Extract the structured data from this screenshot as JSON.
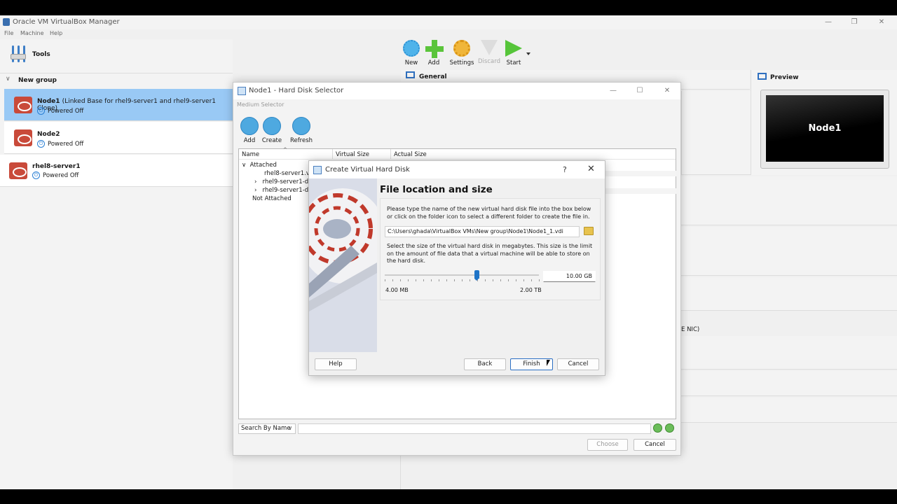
{
  "app": {
    "title": "Oracle VM VirtualBox Manager",
    "menu": [
      "File",
      "Machine",
      "Help"
    ],
    "tools_label": "Tools",
    "group_label": "New group"
  },
  "vms": [
    {
      "name": "Node1",
      "note": "(Linked Base for rhel9-server1 and rhel9-server1 Clone)",
      "state": "Powered Off"
    },
    {
      "name": "Node2",
      "note": "",
      "state": "Powered Off"
    },
    {
      "name": "rhel8-server1",
      "note": "",
      "state": "Powered Off"
    }
  ],
  "toolbar": {
    "new": "New",
    "add": "Add",
    "settings": "Settings",
    "discard": "Discard",
    "start": "Start"
  },
  "details": {
    "general": "General",
    "preview": "Preview",
    "preview_vm": "Node1",
    "nic_fragment": "E NIC)"
  },
  "hds": {
    "title": "Node1 - Hard Disk Selector",
    "section": "Medium Selector",
    "add": "Add",
    "create": "Create",
    "refresh": "Refresh",
    "col_name": "Name",
    "col_virtual": "Virtual Size",
    "col_actual": "Actual Size",
    "attached": "Attached",
    "items": [
      "rhel8-server1.vdi",
      "rhel9-server1-dis",
      "rhel9-server1-dis"
    ],
    "not_attached": "Not Attached",
    "search_mode": "Search By Name",
    "choose": "Choose",
    "cancel": "Cancel"
  },
  "cvhd": {
    "title": "Create Virtual Hard Disk",
    "help_glyph": "?",
    "page_title": "File location and size",
    "desc1": "Please type the name of the new virtual hard disk file into the box below or click on the folder icon to select a different folder to create the file in.",
    "path": "C:\\Users\\ghada\\VirtualBox VMs\\New group\\Node1\\Node1_1.vdi",
    "desc2": "Select the size of the virtual hard disk in megabytes. This size is the limit on the amount of file data that a virtual machine will be able to store on the hard disk.",
    "size": "10.00 GB",
    "min_label": "4.00 MB",
    "max_label": "2.00 TB",
    "btn_help": "Help",
    "btn_back": "Back",
    "btn_finish": "Finish",
    "btn_cancel": "Cancel"
  }
}
